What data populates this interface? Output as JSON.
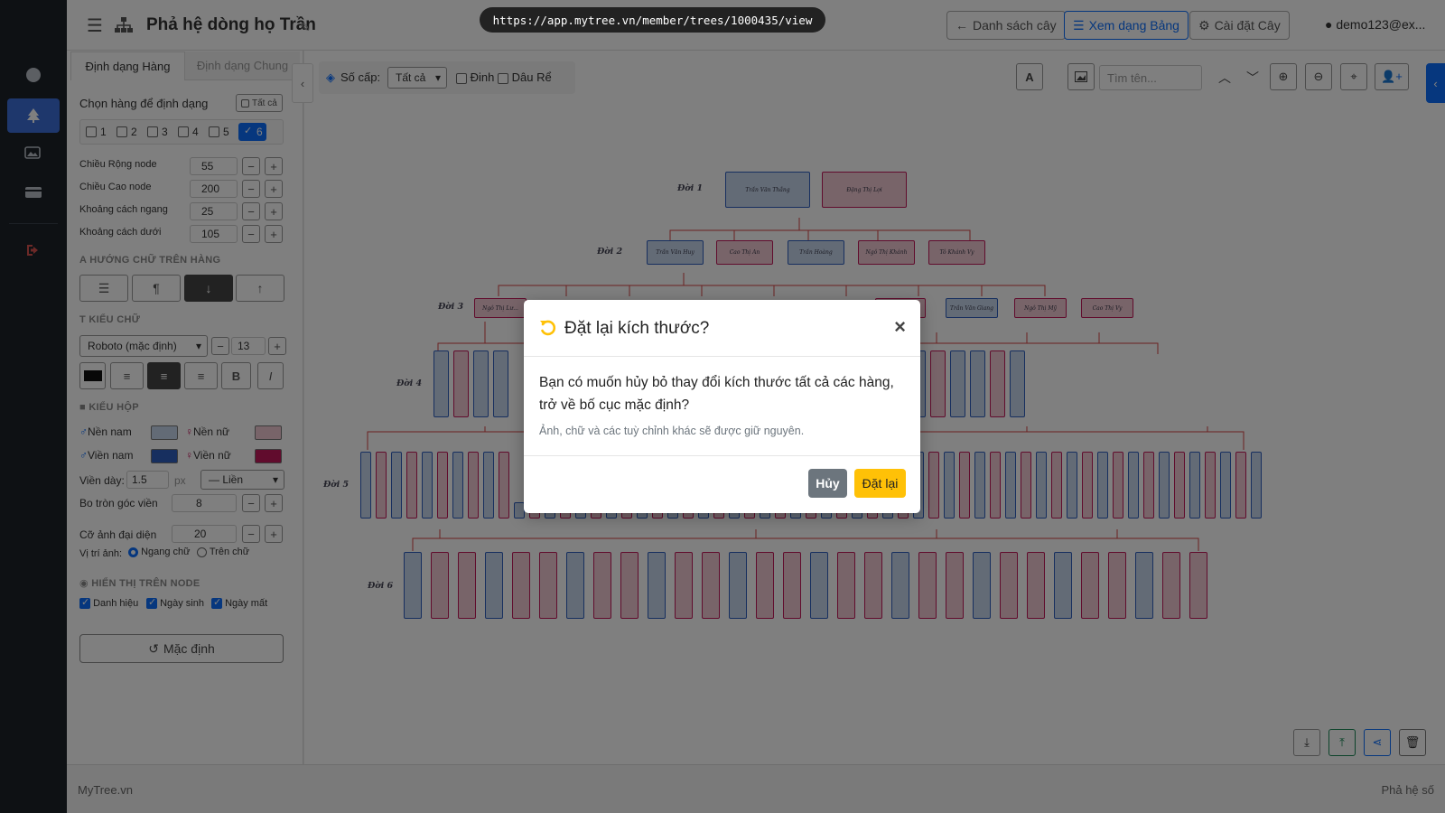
{
  "header": {
    "title": "Phả hệ dòng họ Trần",
    "url": "https://app.mytree.vn/member/trees/1000435/view",
    "buttons": {
      "list": "Danh sách cây",
      "table_view": "Xem dạng Bảng",
      "settings": "Cài đặt Cây"
    },
    "user": "demo123@ex..."
  },
  "panel": {
    "tabs": [
      "Định dạng Hàng",
      "Định dạng Chung"
    ],
    "select_rows_label": "Chọn hàng để định dạng",
    "select_all_label": "Tất cả",
    "rows": [
      "1",
      "2",
      "3",
      "4",
      "5",
      "6"
    ],
    "size_fields": [
      {
        "label": "Chiều Rộng node",
        "value": "55"
      },
      {
        "label": "Chiều Cao node",
        "value": "200"
      },
      {
        "label": "Khoảng cách ngang",
        "value": "25"
      },
      {
        "label": "Khoảng cách dưới",
        "value": "105"
      }
    ],
    "text_direction_title": "HƯỚNG CHỮ TRÊN HÀNG",
    "font_title": "KIỂU CHỮ",
    "font_family": "Roboto (mặc định)",
    "font_size": "13",
    "box_title": "KIỂU HỘP",
    "male_bg_label": "Nền nam",
    "female_bg_label": "Nền nữ",
    "male_border_label": "Viền nam",
    "female_border_label": "Viền nữ",
    "border_width_label": "Viền dày:",
    "border_width_value": "1.5",
    "border_unit": "px",
    "border_style": "— Liền",
    "radius_label": "Bo tròn góc viền",
    "radius_value": "8",
    "avatar_size_label": "Cỡ ảnh đại diện",
    "avatar_size_value": "20",
    "image_pos_label": "Vị trí ảnh:",
    "image_pos_options": [
      "Ngang chữ",
      "Trên chữ"
    ],
    "display_title": "HIỂN THỊ TRÊN NODE",
    "display_options": [
      "Danh hiệu",
      "Ngày sinh",
      "Ngày mất"
    ],
    "reset_label": "Mặc định"
  },
  "canvas": {
    "levels_label": "Số cấp:",
    "levels_value": "Tất cả",
    "dinh_label": "Đinh",
    "dau_re_label": "Dâu Rể",
    "search_placeholder": "Tìm tên...",
    "generations": [
      "Đời 1",
      "Đời 2",
      "Đời 3",
      "Đời 4",
      "Đời 5",
      "Đời 6"
    ],
    "gen1_names": [
      "Trần Văn Thắng",
      "Đặng Thị Lợi"
    ],
    "gen2_names": [
      "Trần Văn Huy",
      "Cao Thị An",
      "Trần Hoàng",
      "Ngô Thị Khánh",
      "Tô Khánh Vy"
    ],
    "gen3_names": [
      "Ngô Thị Lư...",
      "...Thị Vân",
      "Trần Văn Giang",
      "Ngô Thị Mỹ",
      "Cao Thị Vy"
    ]
  },
  "modal": {
    "title": "Đặt lại kích thước?",
    "message": "Bạn có muốn hủy bỏ thay đổi kích thước tất cả các hàng, trở về bố cục mặc định?",
    "note": "Ảnh, chữ và các tuỳ chỉnh khác sẽ được giữ nguyên.",
    "cancel": "Hủy",
    "confirm": "Đặt lại"
  },
  "footer": {
    "left": "MyTree.vn",
    "right": "Phả hệ số"
  },
  "colors": {
    "male_bg": "#c6d6ec",
    "male_border": "#2f5fbf",
    "female_bg": "#f0c9d2",
    "female_border": "#c2185b",
    "link": "#d64545",
    "accent": "#0d6efd",
    "warning": "#ffc107"
  }
}
